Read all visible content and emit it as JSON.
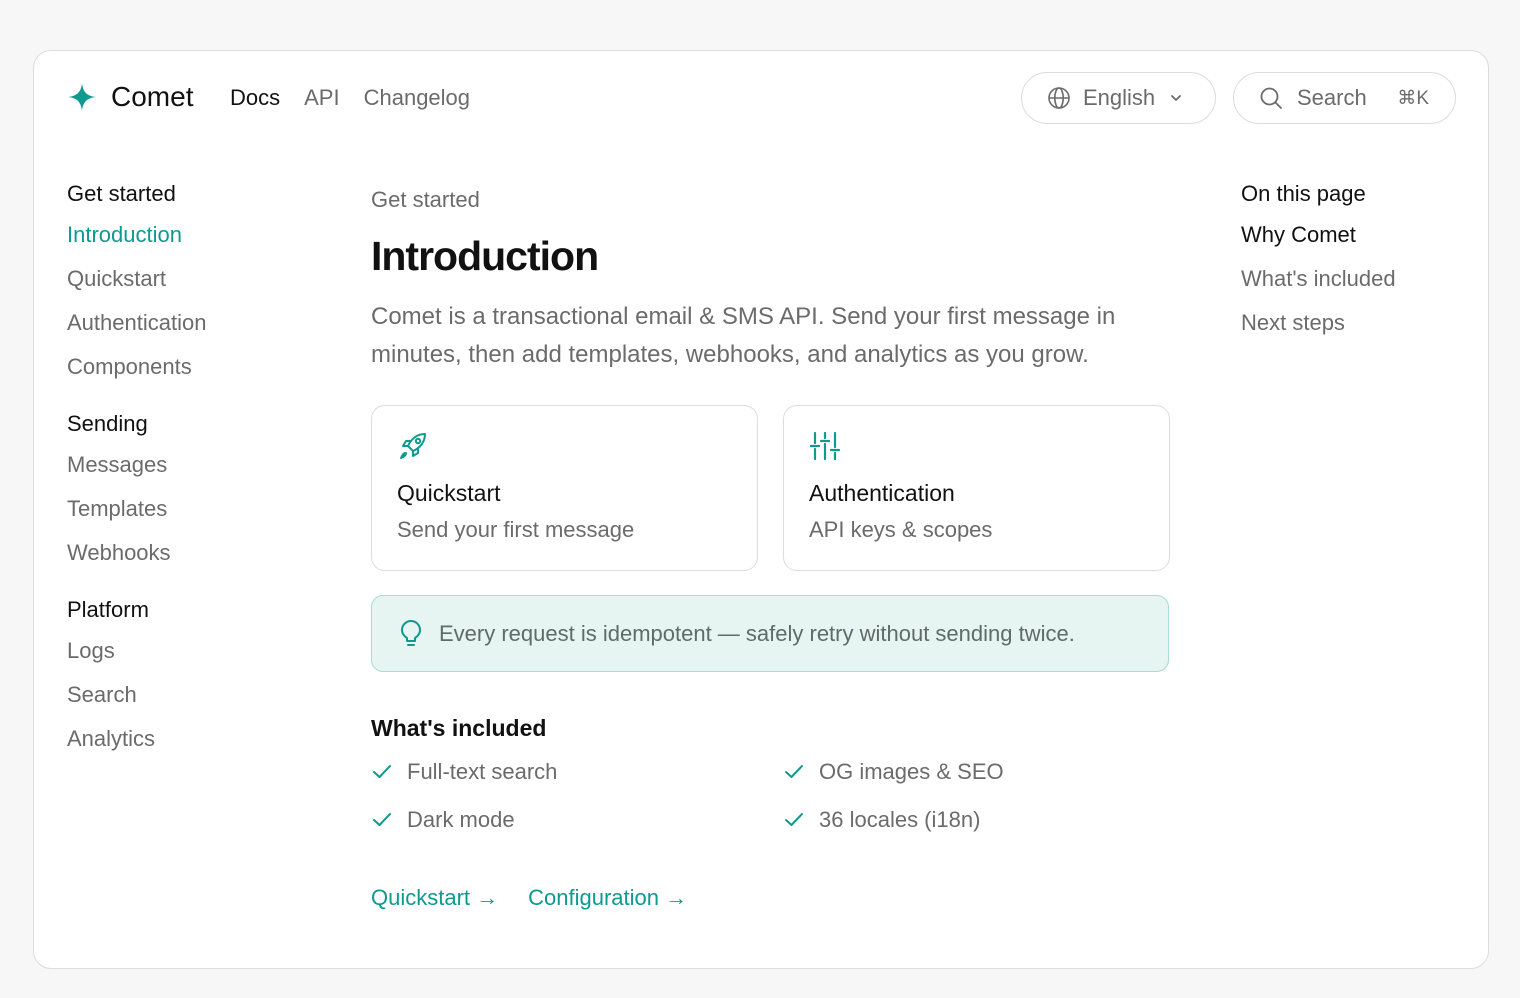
{
  "brand": {
    "name": "Comet",
    "accent": "#0e9a8f"
  },
  "topnav": [
    "Docs",
    "API",
    "Changelog"
  ],
  "language": {
    "label": "English"
  },
  "search": {
    "label": "Search",
    "shortcut": "⌘K"
  },
  "sidebar": {
    "sections": [
      {
        "title": "Get started",
        "items": [
          "Introduction",
          "Quickstart",
          "Authentication",
          "Components"
        ]
      },
      {
        "title": "Sending",
        "items": [
          "Messages",
          "Templates",
          "Webhooks"
        ]
      },
      {
        "title": "Platform",
        "items": [
          "Logs",
          "Search",
          "Analytics"
        ]
      }
    ]
  },
  "main": {
    "eyebrow": "Get started",
    "title": "Introduction",
    "lead": "Comet is a transactional email & SMS API. Send your first message in minutes, then add templates, webhooks, and analytics as you grow.",
    "cards": [
      {
        "icon": "rocket-icon",
        "title": "Quickstart",
        "desc": "Send your first message"
      },
      {
        "icon": "sliders-icon",
        "title": "Authentication",
        "desc": "API keys & scopes"
      }
    ],
    "callout": "Every request is idempotent — safely retry without sending twice.",
    "included_title": "What's included",
    "included": [
      "Full-text search",
      "OG images & SEO",
      "Dark mode",
      "36 locales (i18n)"
    ],
    "links": [
      "Quickstart →",
      "Configuration →"
    ]
  },
  "toc": {
    "title": "On this page",
    "items": [
      "Why Comet",
      "What's included",
      "Next steps"
    ]
  }
}
